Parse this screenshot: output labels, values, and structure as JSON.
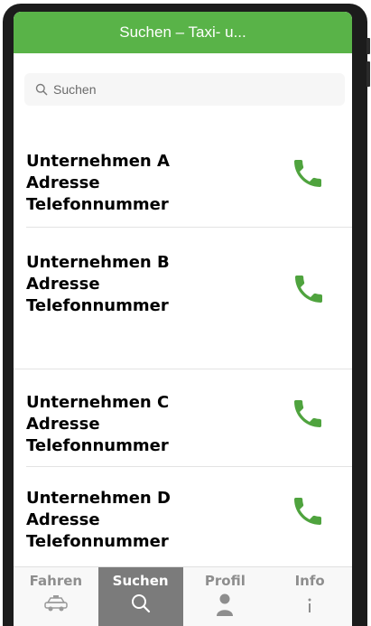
{
  "navbar": {
    "title": "Suchen – Taxi- u..."
  },
  "search": {
    "placeholder": "Suchen",
    "icon": "search-icon"
  },
  "companies": [
    {
      "name": "Unternehmen A",
      "address": "Adresse",
      "phone": "Telefonnummer"
    },
    {
      "name": "Unternehmen B",
      "address": "Adresse",
      "phone": "Telefonnummer"
    },
    {
      "name": "Unternehmen C",
      "address": "Adresse",
      "phone": "Telefonnummer"
    },
    {
      "name": "Unternehmen D",
      "address": "Adresse",
      "phone": "Telefonnummer"
    }
  ],
  "tabs": [
    {
      "label": "Fahren",
      "icon": "taxi-icon"
    },
    {
      "label": "Suchen",
      "icon": "search-icon",
      "active": true
    },
    {
      "label": "Profil",
      "icon": "person-icon"
    },
    {
      "label": "Info",
      "icon": "info-icon"
    }
  ],
  "colors": {
    "accent": "#59b348",
    "phone": "#4fa33e",
    "tab_active": "#7b7b7b"
  }
}
